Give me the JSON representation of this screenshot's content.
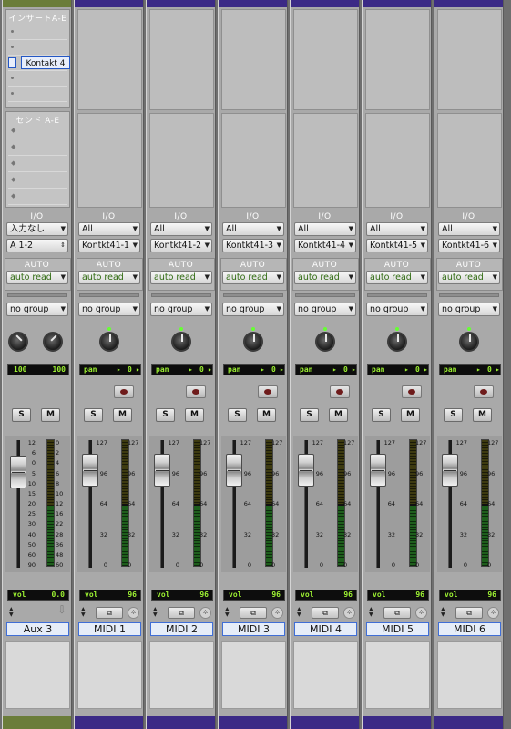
{
  "sections": {
    "inserts_label": "インサートA-E",
    "sends_label": "センド A-E",
    "io_label": "I/O",
    "auto_label": "AUTO"
  },
  "colors": {
    "midi_track": "#3b2a86",
    "aux_track": "#6b7d3a",
    "meter_green": "#1e5e1c",
    "lcd_text": "#9cf032",
    "selection_blue": "#3f6ed6"
  },
  "strips": [
    {
      "name": "Aux 3",
      "kind": "aux",
      "insert_plugin": "Kontakt 4",
      "input": "入力なし",
      "output": "A 1-2",
      "automation": "auto read",
      "group": "no group",
      "pan_left": "100",
      "pan_right": "100",
      "vol_label": "vol",
      "vol_value": "0.0",
      "solo": "S",
      "mute": "M",
      "scale": [
        "12",
        "6",
        "0",
        "5",
        "10",
        "15",
        "20",
        "25",
        "30",
        "40",
        "50",
        "60",
        "90"
      ],
      "meter_scale": [
        "0",
        "2",
        "4",
        "6",
        "8",
        "10",
        "12",
        "16",
        "22",
        "28",
        "36",
        "48",
        "60"
      ]
    },
    {
      "name": "MIDI 1",
      "kind": "midi",
      "input": "All",
      "output": "Kontkt41-1",
      "automation": "auto read",
      "group": "no group",
      "pan_label": "pan",
      "pan_value": "0",
      "vol_label": "vol",
      "vol_value": "96",
      "solo": "S",
      "mute": "M",
      "scale": [
        "127",
        "96",
        "64",
        "32",
        "0"
      ],
      "meter_scale": [
        "127",
        "96",
        "64",
        "32",
        "0"
      ]
    },
    {
      "name": "MIDI 2",
      "kind": "midi",
      "input": "All",
      "output": "Kontkt41-2",
      "automation": "auto read",
      "group": "no group",
      "pan_label": "pan",
      "pan_value": "0",
      "vol_label": "vol",
      "vol_value": "96",
      "solo": "S",
      "mute": "M",
      "scale": [
        "127",
        "96",
        "64",
        "32",
        "0"
      ],
      "meter_scale": [
        "127",
        "96",
        "64",
        "32",
        "0"
      ]
    },
    {
      "name": "MIDI 3",
      "kind": "midi",
      "input": "All",
      "output": "Kontkt41-3",
      "automation": "auto read",
      "group": "no group",
      "pan_label": "pan",
      "pan_value": "0",
      "vol_label": "vol",
      "vol_value": "96",
      "solo": "S",
      "mute": "M",
      "scale": [
        "127",
        "96",
        "64",
        "32",
        "0"
      ],
      "meter_scale": [
        "127",
        "96",
        "64",
        "32",
        "0"
      ]
    },
    {
      "name": "MIDI 4",
      "kind": "midi",
      "input": "All",
      "output": "Kontkt41-4",
      "automation": "auto read",
      "group": "no group",
      "pan_label": "pan",
      "pan_value": "0",
      "vol_label": "vol",
      "vol_value": "96",
      "solo": "S",
      "mute": "M",
      "scale": [
        "127",
        "96",
        "64",
        "32",
        "0"
      ],
      "meter_scale": [
        "127",
        "96",
        "64",
        "32",
        "0"
      ]
    },
    {
      "name": "MIDI 5",
      "kind": "midi",
      "input": "All",
      "output": "Kontkt41-5",
      "automation": "auto read",
      "group": "no group",
      "pan_label": "pan",
      "pan_value": "0",
      "vol_label": "vol",
      "vol_value": "96",
      "solo": "S",
      "mute": "M",
      "scale": [
        "127",
        "96",
        "64",
        "32",
        "0"
      ],
      "meter_scale": [
        "127",
        "96",
        "64",
        "32",
        "0"
      ]
    },
    {
      "name": "MIDI 6",
      "kind": "midi",
      "input": "All",
      "output": "Kontkt41-6",
      "automation": "auto read",
      "group": "no group",
      "pan_label": "pan",
      "pan_value": "0",
      "vol_label": "vol",
      "vol_value": "96",
      "solo": "S",
      "mute": "M",
      "scale": [
        "127",
        "96",
        "64",
        "32",
        "0"
      ],
      "meter_scale": [
        "127",
        "96",
        "64",
        "32",
        "0"
      ]
    }
  ]
}
